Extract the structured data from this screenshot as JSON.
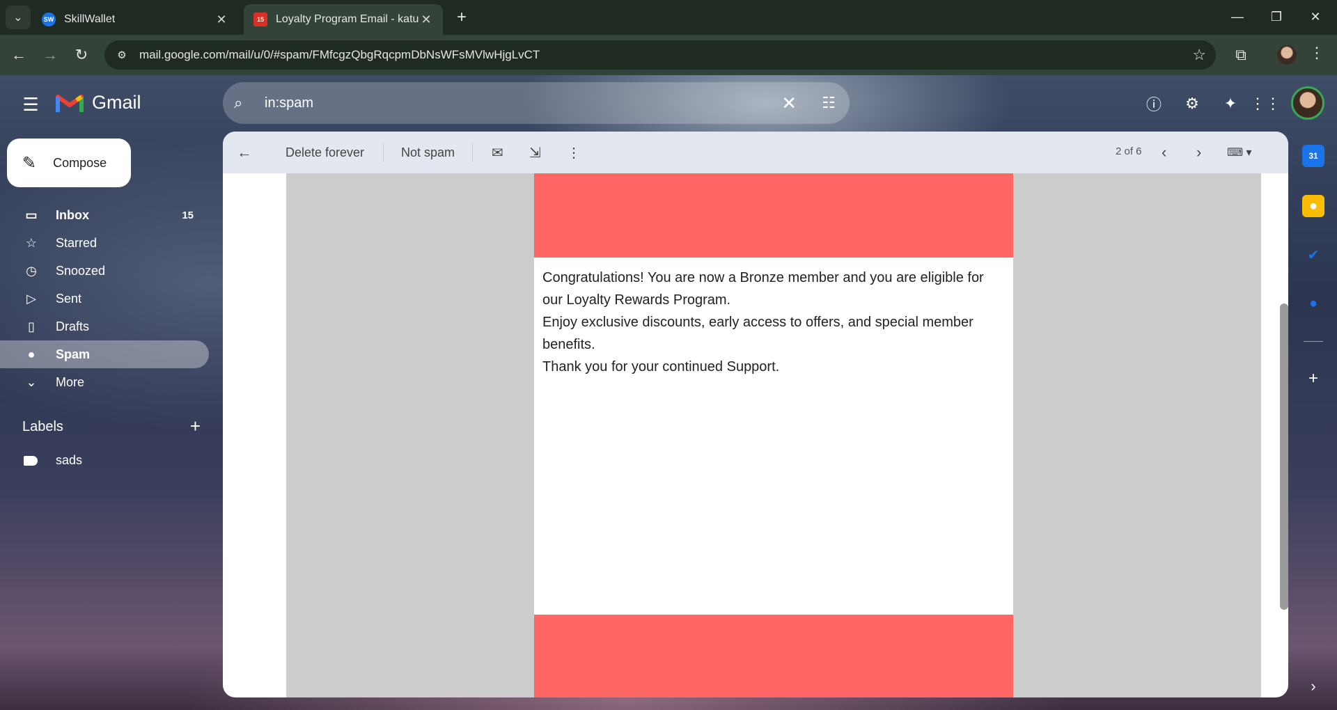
{
  "browser": {
    "tabs": [
      {
        "title": "SkillWallet",
        "favicon": "SW"
      },
      {
        "title": "Loyalty Program Email - katukam",
        "favicon": "15"
      }
    ],
    "url": "mail.google.com/mail/u/0/#spam/FMfcgzQbgRqcpmDbNsWFsMVlwHjgLvCT"
  },
  "gmail": {
    "logo": "Gmail",
    "search": {
      "query": "in:spam"
    },
    "compose": "Compose",
    "nav": [
      {
        "label": "Inbox",
        "count": "15"
      },
      {
        "label": "Starred"
      },
      {
        "label": "Snoozed"
      },
      {
        "label": "Sent"
      },
      {
        "label": "Drafts"
      },
      {
        "label": "Spam"
      },
      {
        "label": "More"
      }
    ],
    "labels_title": "Labels",
    "labels": [
      "sads"
    ],
    "toolbar": {
      "delete_forever": "Delete forever",
      "not_spam": "Not spam",
      "pager": "2 of 6"
    },
    "email": {
      "line1": "Congratulations! You are now a Bronze member and you are eligible for our Loyalty Rewards Program.",
      "line2": "Enjoy exclusive discounts, early access to offers, and special member benefits.",
      "line3": "Thank you for your continued Support."
    }
  },
  "colors": {
    "banner_red": "#ff6666",
    "selected_nav": "rgba(255,255,255,0.35)"
  }
}
